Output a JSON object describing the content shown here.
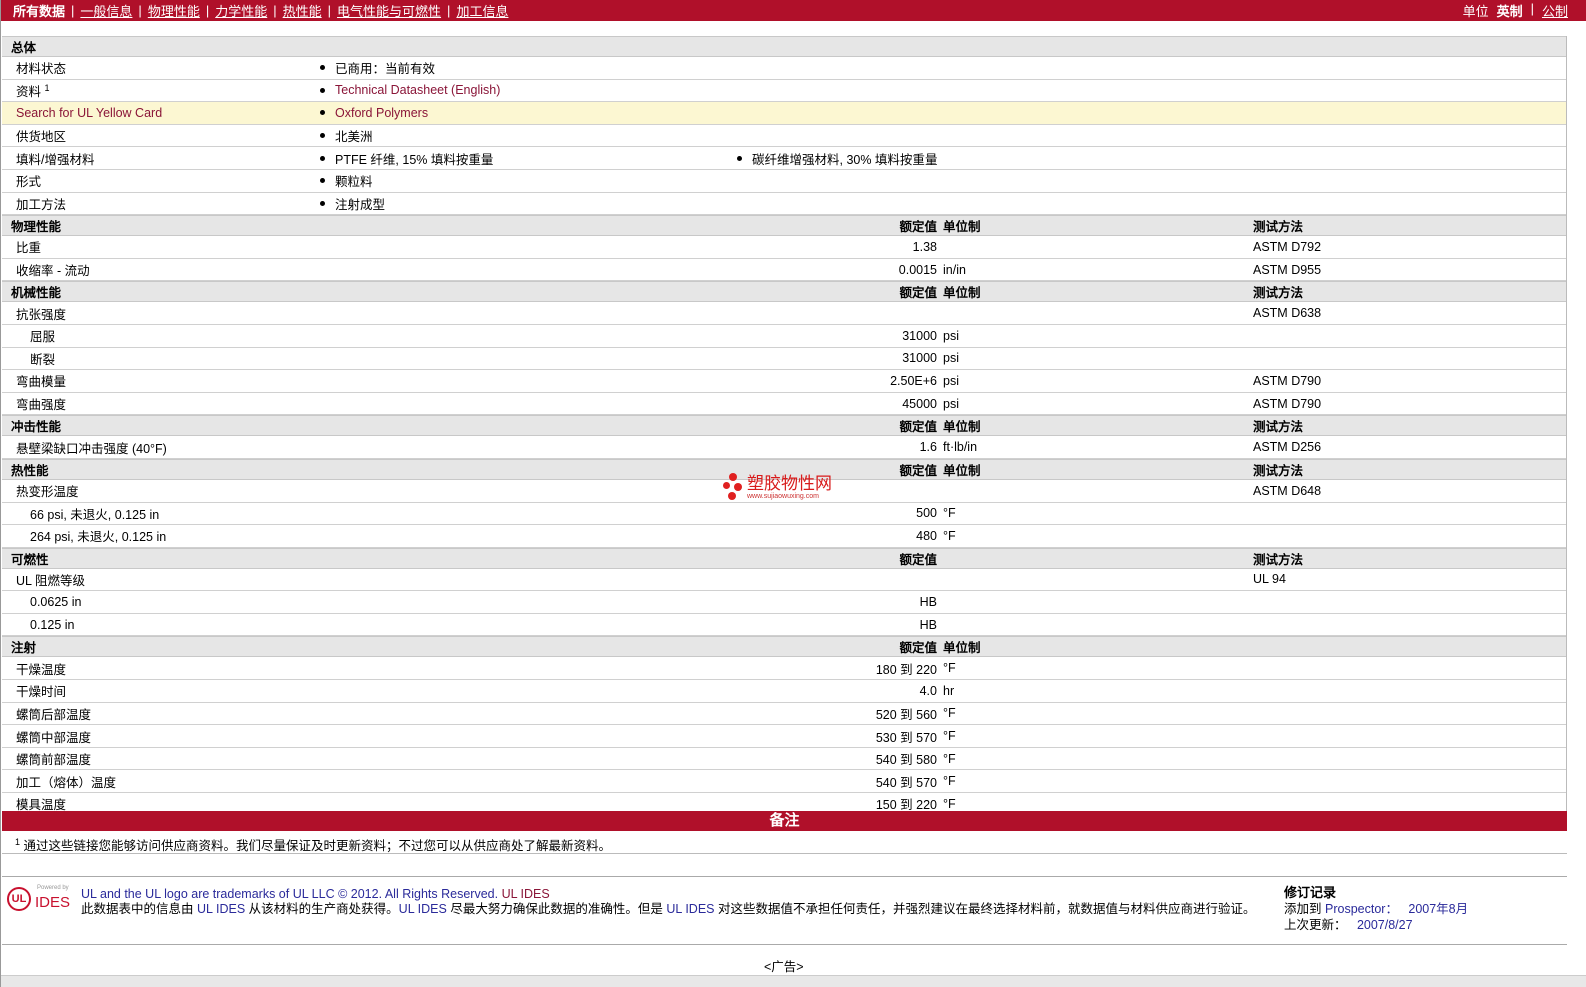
{
  "nav": {
    "items": [
      "所有数据",
      "一般信息",
      "物理性能",
      "力学性能",
      "热性能",
      "电气性能与可燃性",
      "加工信息"
    ],
    "units_label": "单位",
    "units": [
      "英制",
      "公制"
    ]
  },
  "general": {
    "title": "总体",
    "rows": [
      {
        "label": "材料状态",
        "values": [
          "已商用：当前有效"
        ]
      },
      {
        "label": "资料",
        "sup": "1",
        "values": [
          "Technical Datasheet (English)"
        ],
        "link": true
      },
      {
        "label": "Search for UL Yellow Card",
        "values": [
          "Oxford Polymers"
        ],
        "link": true,
        "highlight": true
      },
      {
        "label": "供货地区",
        "values": [
          "北美洲"
        ]
      },
      {
        "label": "填料/增强材料",
        "values": [
          "PTFE 纤维, 15% 填料按重量",
          "碳纤维增强材料, 30% 填料按重量"
        ]
      },
      {
        "label": "形式",
        "values": [
          "颗粒料"
        ]
      },
      {
        "label": "加工方法",
        "values": [
          "注射成型"
        ]
      }
    ]
  },
  "sections": [
    {
      "title": "物理性能",
      "h_value": "额定值",
      "h_unit": "单位制",
      "h_test": "测试方法",
      "rows": [
        {
          "label": "比重",
          "value": "1.38",
          "unit": "",
          "test": "ASTM D792"
        },
        {
          "label": "收缩率  - 流动",
          "value": "0.0015",
          "unit": "in/in",
          "test": "ASTM D955"
        }
      ]
    },
    {
      "title": "机械性能",
      "h_value": "额定值",
      "h_unit": "单位制",
      "h_test": "测试方法",
      "rows": [
        {
          "label": "抗张强度",
          "value": "",
          "unit": "",
          "test": "ASTM D638"
        },
        {
          "label": "屈服",
          "sub": true,
          "value": "31000",
          "unit": "psi",
          "test": ""
        },
        {
          "label": "断裂",
          "sub": true,
          "value": "31000",
          "unit": "psi",
          "test": ""
        },
        {
          "label": "弯曲模量",
          "value": "2.50E+6",
          "unit": "psi",
          "test": "ASTM D790"
        },
        {
          "label": "弯曲强度",
          "value": "45000",
          "unit": "psi",
          "test": "ASTM D790"
        }
      ]
    },
    {
      "title": "冲击性能",
      "h_value": "额定值",
      "h_unit": "单位制",
      "h_test": "测试方法",
      "rows": [
        {
          "label": "悬壁梁缺口冲击强度 (40°F)",
          "value": "1.6",
          "unit": "ft·lb/in",
          "test": "ASTM D256"
        }
      ]
    },
    {
      "title": "热性能",
      "h_value": "额定值",
      "h_unit": "单位制",
      "h_test": "测试方法",
      "rows": [
        {
          "label": "热变形温度",
          "value": "",
          "unit": "",
          "test": "ASTM D648"
        },
        {
          "label": "66 psi, 未退火, 0.125 in",
          "sub": true,
          "value": "500",
          "unit": "°F",
          "test": ""
        },
        {
          "label": "264 psi, 未退火, 0.125 in",
          "sub": true,
          "value": "480",
          "unit": "°F",
          "test": ""
        }
      ]
    },
    {
      "title": "可燃性",
      "h_value": "额定值",
      "h_unit": "",
      "h_test": "测试方法",
      "rows": [
        {
          "label": "UL 阻燃等级",
          "value": "",
          "unit": "",
          "test": "UL 94"
        },
        {
          "label": "0.0625 in",
          "sub": true,
          "value": "HB",
          "unit": "",
          "test": ""
        },
        {
          "label": "0.125 in",
          "sub": true,
          "value": "HB",
          "unit": "",
          "test": ""
        }
      ]
    },
    {
      "title": "注射",
      "h_value": "额定值",
      "h_unit": "单位制",
      "h_test": "",
      "rows": [
        {
          "label": "干燥温度",
          "value": "180 到  220",
          "unit": "°F",
          "test": ""
        },
        {
          "label": "干燥时间",
          "value": "4.0",
          "unit": "hr",
          "test": ""
        },
        {
          "label": "螺筒后部温度",
          "value": "520 到  560",
          "unit": "°F",
          "test": ""
        },
        {
          "label": "螺筒中部温度",
          "value": "530 到  570",
          "unit": "°F",
          "test": ""
        },
        {
          "label": "螺筒前部温度",
          "value": "540 到  580",
          "unit": "°F",
          "test": ""
        },
        {
          "label": "加工（熔体）温度",
          "value": "540 到  570",
          "unit": "°F",
          "test": ""
        },
        {
          "label": "模具温度",
          "value": "150 到  220",
          "unit": "°F",
          "test": ""
        }
      ]
    }
  ],
  "notes": {
    "title": "备注",
    "footnote_num": "1",
    "footnote": "通过这些链接您能够访问供应商资料。我们尽量保证及时更新资料；不过您可以从供应商处了解最新资料。"
  },
  "footer": {
    "logo_text": "Powered by UL IDES",
    "trademark": "UL and the UL logo are trademarks of UL LLC © 2012. All Rights Reserved.",
    "ides_link": "UL IDES",
    "disclaimer_1": "此数据表中的信息由",
    "ul_ides": "UL IDES",
    "disclaimer_2": "从该材料的生产商处获得。",
    "disclaimer_3": "尽最大努力确保此数据的准确性。但是",
    "disclaimer_4": "对这些数据值不承担任何责任，并强烈建议在最终选择材料前，就数据值与材料供应商进行验证。"
  },
  "revision": {
    "title": "修订记录",
    "added_label": "添加到",
    "prospector": "Prospector：",
    "added_date": "2007年8月",
    "updated_label": "上次更新：",
    "updated_date": "2007/8/27"
  },
  "ad": "<广告>",
  "watermark": {
    "text": "塑胶物性网",
    "url": "www.sujiaowuxing.com"
  },
  "colors": {
    "brand": "#b0102a",
    "header_bg": "#e6e6e6",
    "highlight": "#fcf7d2",
    "link": "#8a1538"
  }
}
